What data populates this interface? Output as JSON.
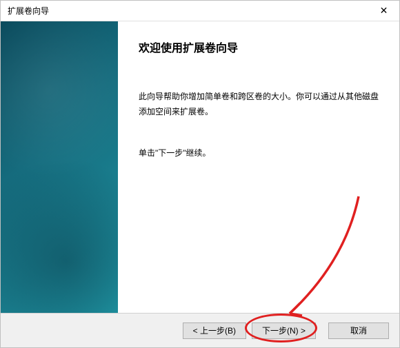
{
  "titlebar": {
    "title": "扩展卷向导",
    "close_label": "✕"
  },
  "content": {
    "heading": "欢迎使用扩展卷向导",
    "description": "此向导帮助你增加简单卷和跨区卷的大小。你可以通过从其他磁盘添加空间来扩展卷。",
    "instruction": "单击\"下一步\"继续。"
  },
  "buttons": {
    "back": "< 上一步(B)",
    "next": "下一步(N) >",
    "cancel": "取消"
  }
}
